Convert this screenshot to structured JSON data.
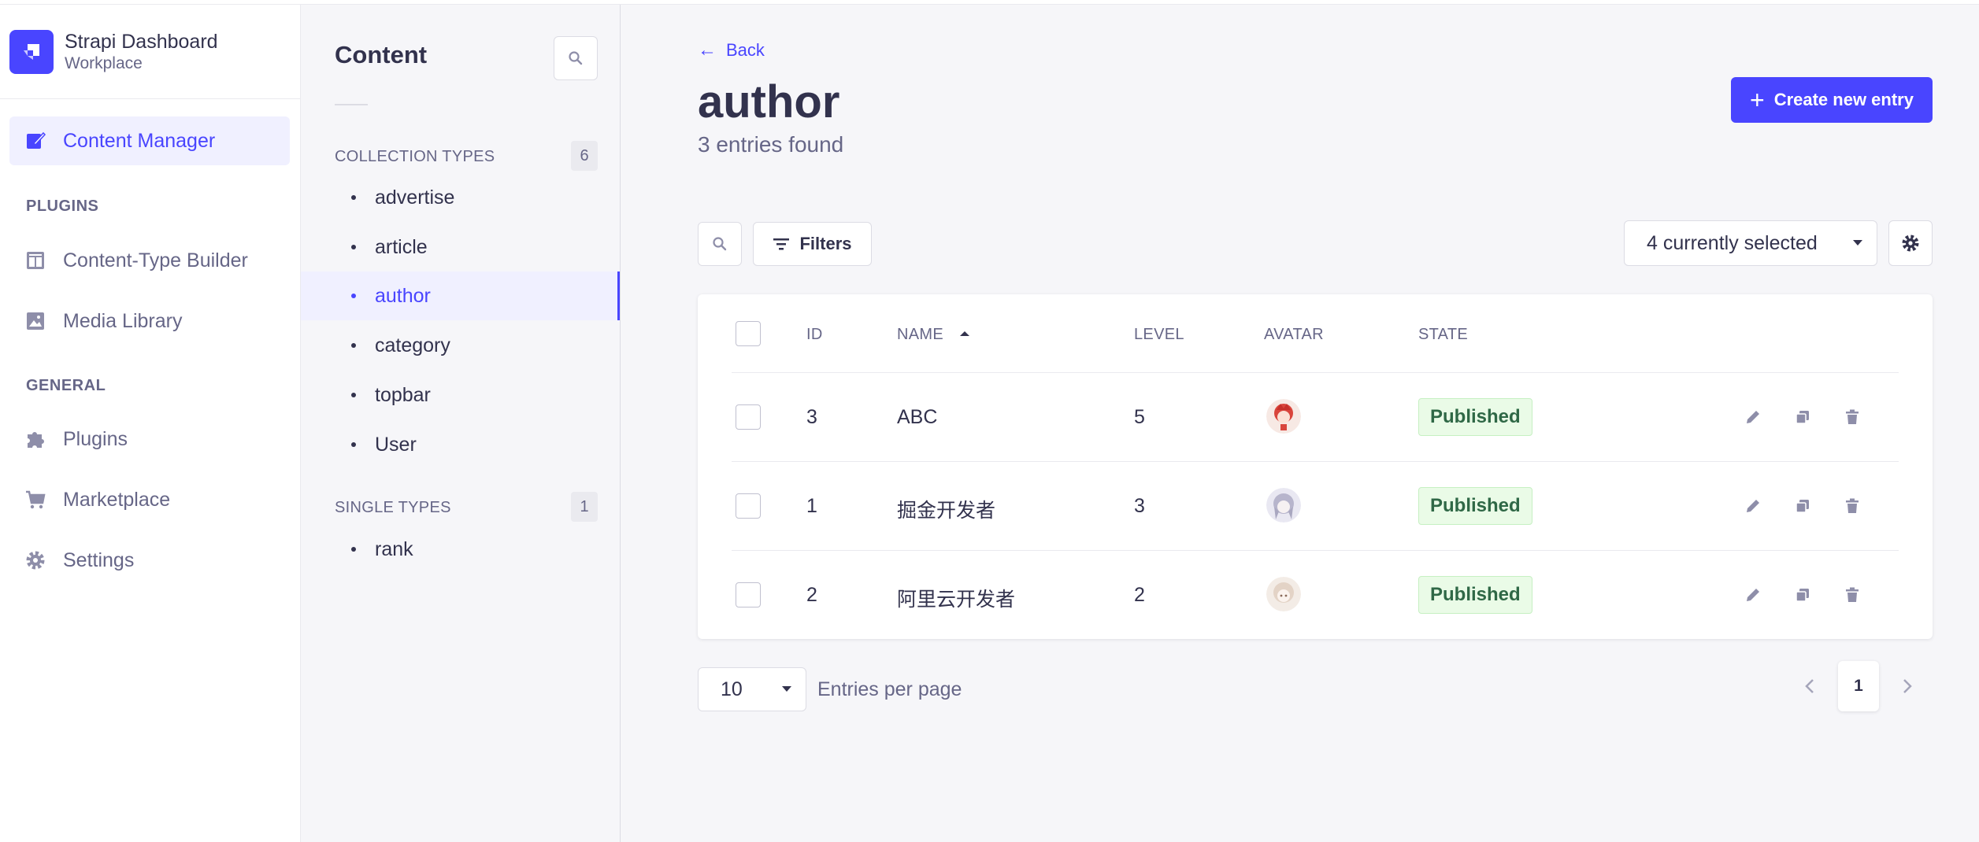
{
  "brand": {
    "title": "Strapi Dashboard",
    "subtitle": "Workplace",
    "color": "#4945ff"
  },
  "mainnav": {
    "content_manager": "Content Manager",
    "plugins_heading": "PLUGINS",
    "content_type_builder": "Content-Type Builder",
    "media_library": "Media Library",
    "general_heading": "GENERAL",
    "plugins": "Plugins",
    "marketplace": "Marketplace",
    "settings": "Settings"
  },
  "subnav": {
    "title": "Content",
    "collection_heading": "COLLECTION TYPES",
    "collection_count": "6",
    "collection_types": [
      "advertise",
      "article",
      "author",
      "category",
      "topbar",
      "User"
    ],
    "single_heading": "SINGLE TYPES",
    "single_count": "1",
    "single_types": [
      "rank"
    ]
  },
  "header": {
    "back": "Back",
    "title": "author",
    "subtitle": "3 entries found",
    "create_label": "Create new entry"
  },
  "toolbar": {
    "filters_label": "Filters",
    "columns_selected": "4 currently selected"
  },
  "table": {
    "columns": [
      "ID",
      "NAME",
      "LEVEL",
      "AVATAR",
      "STATE"
    ],
    "rows": [
      {
        "id": "3",
        "name": "ABC",
        "level": "5",
        "state": "Published"
      },
      {
        "id": "1",
        "name": "掘金开发者",
        "level": "3",
        "state": "Published"
      },
      {
        "id": "2",
        "name": "阿里云开发者",
        "level": "2",
        "state": "Published"
      }
    ]
  },
  "pagination": {
    "per_page_value": "10",
    "per_page_label": "Entries per page",
    "current_page": "1"
  }
}
